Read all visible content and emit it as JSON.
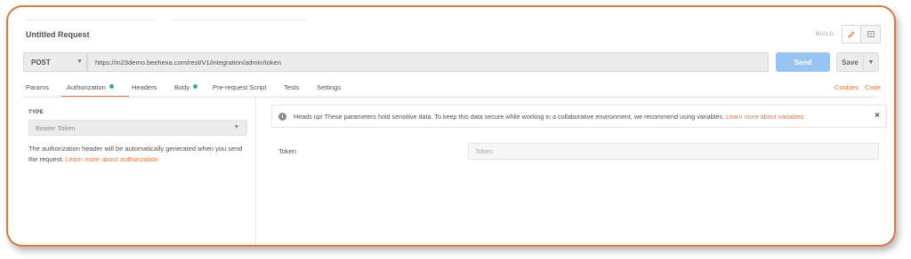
{
  "request": {
    "title": "Untitled Request",
    "build_label": "BUILD",
    "method": "POST",
    "url": "https://m23demo.beehexa.com/rest/V1/integration/admin/token",
    "send_label": "Send",
    "save_label": "Save"
  },
  "tabs": [
    {
      "label": "Params",
      "dot": false
    },
    {
      "label": "Authorization",
      "dot": true
    },
    {
      "label": "Headers",
      "dot": false
    },
    {
      "label": "Body",
      "dot": true
    },
    {
      "label": "Pre-request Script",
      "dot": false
    },
    {
      "label": "Tests",
      "dot": false
    },
    {
      "label": "Settings",
      "dot": false
    }
  ],
  "active_tab": "Authorization",
  "links": {
    "cookies": "Cookies",
    "code": "Code"
  },
  "auth": {
    "type_label": "TYPE",
    "type_value": "Bearer Token",
    "help_text": "The authorization header will be automatically generated when you send the request.",
    "help_link": "Learn more about authorization"
  },
  "notice": {
    "text": "Heads up! These parameters hold sensitive data. To keep this data secure while working in a collaborative environment, we recommend using variables.",
    "link": "Learn more about variables"
  },
  "token": {
    "label": "Token",
    "placeholder": "Token",
    "value": ""
  },
  "colors": {
    "accent": "#e6763f",
    "send": "#97c4f3",
    "dot": "#26b47f"
  }
}
